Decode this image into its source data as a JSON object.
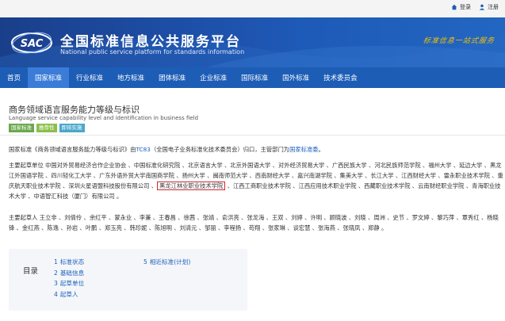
{
  "topbar": {
    "login_label": "登录",
    "register_label": "注册"
  },
  "header": {
    "logo_text": "SAC",
    "site_title": "全国标准信息公共服务平台",
    "site_subtitle": "National public service platform  for standards information",
    "slogan": "标准信息一站式服务"
  },
  "nav": {
    "items": [
      {
        "label": "首页",
        "active": false
      },
      {
        "label": "国家标准",
        "active": true
      },
      {
        "label": "行业标准",
        "active": false
      },
      {
        "label": "地方标准",
        "active": false
      },
      {
        "label": "团体标准",
        "active": false
      },
      {
        "label": "企业标准",
        "active": false
      },
      {
        "label": "国际标准",
        "active": false
      },
      {
        "label": "国外标准",
        "active": false
      },
      {
        "label": "技术委员会",
        "active": false
      }
    ]
  },
  "standard": {
    "title": "商务领域语言服务能力等级与标识",
    "subtitle": "Language service capability level and identification in business field",
    "badges": [
      {
        "label": "国家标准",
        "color": "#6aa84f"
      },
      {
        "label": "推荐性",
        "color": "#8dbf4a"
      },
      {
        "label": "即将实施",
        "color": "#4aa8c9"
      }
    ]
  },
  "body": {
    "p1_prefix": "国家标准《商务领域语言服务能力等级与标识》由",
    "p1_tc": "TC83",
    "p1_mid": "（全国电子业务标准化技术委员会）归口，主管部门为",
    "p1_dept": "国家标准委",
    "p1_suffix": "。",
    "p2_before": "主要起草单位 中国对外贸易经济合作企业协会 、中国标准化研究院 、北京语言大学 、北京外国语大学 、对外经济贸易大学 、广西民族大学 、河北民族师范学院 、福州大学 、延边大学 、黑龙江外国语学院 、四川轻化工大学 、广东外语外贸大学南国商学院 、扬州大学 、闽南师范大学 、西南财经大学 、嘉兴南湖学院 、集美大学 、长江大学 、江西财经大学 、雷永职业技术学院 、重庆航天职业技术学院 、深圳火星语盟科技股份有限公司 、",
    "p2_highlight": "黑龙江林业职业技术学院",
    "p2_after": " 、江西工商职业技术学院 、江西应用技术职业学院 、西藏职业技术学院 、云南财经职业学院 、青海职业技术大学 、中语智汇科技（厦门）有限公司 。",
    "p3": "主要起草人 王立非 、刘倩伶 、余红平 、蒙永业 、李兼 、王春昌 、徐茜 、张靖 、俞洪亮 、张龙海 、王双 、刘婷 、许明 、顾晓波 、刘晓 、周洲 、史节 、罗文婷 、黎巧萍 、覃秀红 、杨晓锋 、金红燕 、陈逸 、孙岩 、叶鹏 、郑玉亮 、韩珍妮 、陈旭明 、刘清元 、邹丽 、李程扬 、苟翔 、张家琳 、谈宏慧 、张海燕 、张晓凤 、郑静 。"
  },
  "toc": {
    "label": "目录",
    "col1": [
      {
        "num": "1",
        "label": "标准状态"
      },
      {
        "num": "2",
        "label": "基础信息"
      },
      {
        "num": "3",
        "label": "起草单位"
      },
      {
        "num": "4",
        "label": "起草人"
      }
    ],
    "col2": [
      {
        "num": "5",
        "label": "相近标准(计划)"
      }
    ]
  }
}
